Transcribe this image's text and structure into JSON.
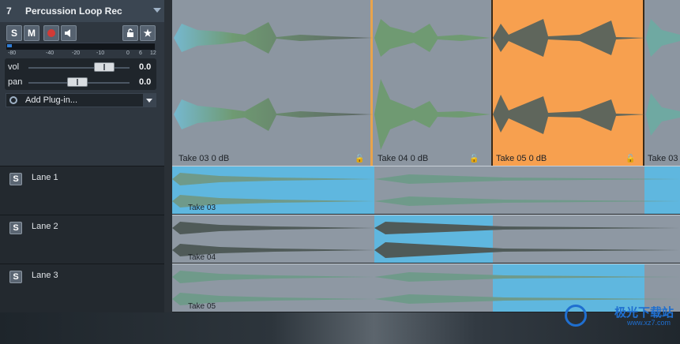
{
  "track": {
    "number": "7",
    "name": "Percussion Loop Rec",
    "buttons": {
      "solo": "S",
      "mute": "M"
    },
    "meter_scale": [
      "-80",
      "-40",
      "-20",
      "-10",
      "0",
      "6",
      "12"
    ],
    "vol": {
      "label": "vol",
      "value": "0.0"
    },
    "pan": {
      "label": "pan",
      "value": "0.0"
    },
    "add_plugin": "Add Plug-in..."
  },
  "main_lane": {
    "events": [
      {
        "label": "Take 03   0 dB",
        "color": "#8c96a1"
      },
      {
        "label": "Take 04   0 dB",
        "color": "#8c96a1"
      },
      {
        "label": "Take 05   0 dB",
        "color": "#f7a04f"
      },
      {
        "label": "Take 03",
        "color": "#8c96a1"
      }
    ]
  },
  "lanes": [
    {
      "solo": "S",
      "name": "Lane  1",
      "take": "Take 03"
    },
    {
      "solo": "S",
      "name": "Lane  2",
      "take": "Take 04"
    },
    {
      "solo": "S",
      "name": "Lane  3",
      "take": "Take 05"
    }
  ],
  "watermark": {
    "title": "极光下载站",
    "url": "www.xz7.com"
  },
  "colors": {
    "selected": "#f7a04f",
    "comp_blue": "#5fb7df",
    "lane_gray": "#8e98a3"
  }
}
